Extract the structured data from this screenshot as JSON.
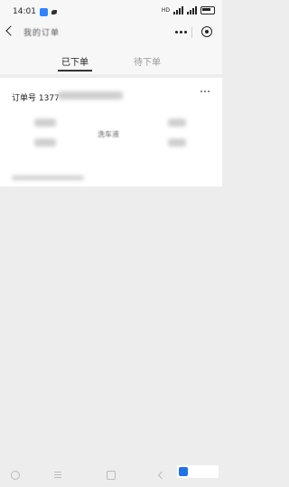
{
  "status_bar": {
    "time": "14:01",
    "right_text": "HD"
  },
  "nav": {
    "title": "我的订单"
  },
  "tabs": [
    {
      "label": "已下单",
      "active": true
    },
    {
      "label": "待下单",
      "active": false
    }
  ],
  "order": {
    "number_label": "订单号 1377",
    "product_name": "洗车液"
  },
  "colors": {
    "background": "#ededed",
    "card": "#ffffff",
    "accent": "#333333"
  }
}
